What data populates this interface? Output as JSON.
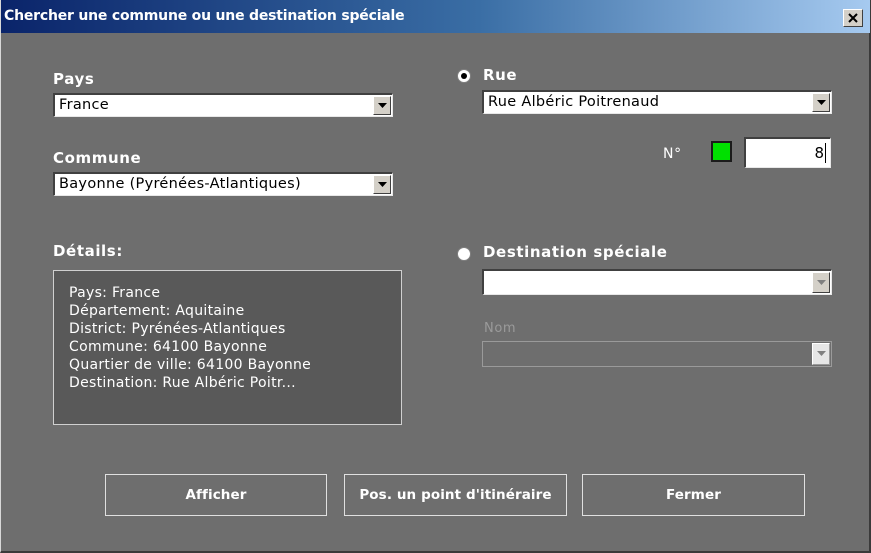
{
  "window": {
    "title": "Chercher une commune ou une destination spéciale"
  },
  "left": {
    "country_label": "Pays",
    "country_value": "France",
    "city_label": "Commune",
    "city_value": "Bayonne (Pyrénées-Atlantiques)",
    "details_label": "Détails:",
    "details_lines": [
      "Pays: France",
      "Département: Aquitaine",
      "District: Pyrénées-Atlantiques",
      "Commune: 64100 Bayonne",
      "Quartier de ville: 64100 Bayonne",
      "Destination: Rue Albéric Poitr..."
    ]
  },
  "right": {
    "street_radio_label": "Rue",
    "street_radio_selected": true,
    "street_value": "Rue Albéric Poitrenaud",
    "number_label": "N°",
    "number_value": "8",
    "indicator_color": "#00e000",
    "special_radio_label": "Destination spéciale",
    "special_radio_selected": false,
    "special_value": "",
    "name_label": "Nom",
    "name_value": ""
  },
  "buttons": {
    "show": "Afficher",
    "waypoint": "Pos. un point d'itinéraire",
    "close": "Fermer"
  },
  "colors": {
    "background": "#6e6e6e",
    "titlebar_start": "#0a246a",
    "titlebar_end": "#a6caf0"
  }
}
